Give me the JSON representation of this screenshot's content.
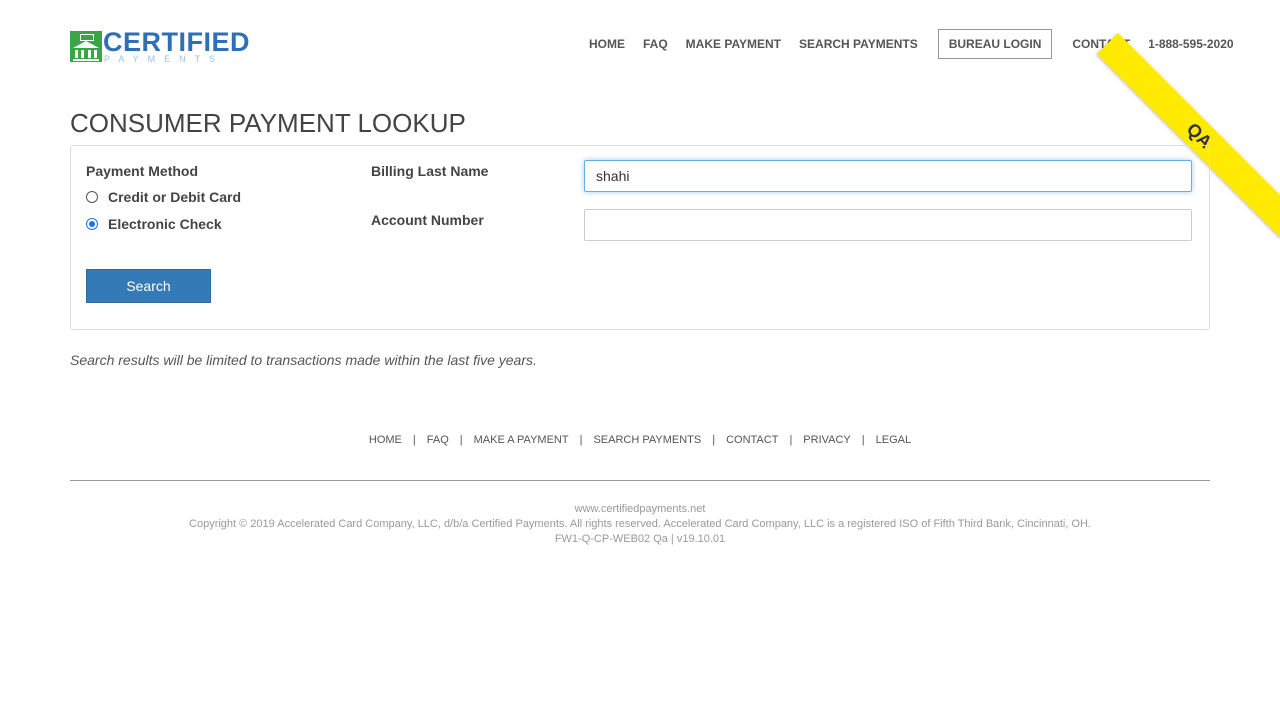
{
  "header": {
    "logo_text": "CERTIFIED",
    "logo_sub": "PAYMENTS",
    "nav": [
      {
        "label": "HOME"
      },
      {
        "label": "FAQ"
      },
      {
        "label": "MAKE PAYMENT"
      },
      {
        "label": "SEARCH PAYMENTS"
      },
      {
        "label": "BUREAU LOGIN"
      },
      {
        "label": "CONTACT"
      },
      {
        "label": "1-888-595-2020"
      }
    ],
    "ribbon": "QA"
  },
  "page": {
    "title": "CONSUMER PAYMENT LOOKUP"
  },
  "form": {
    "payment_method_label": "Payment Method",
    "options": [
      {
        "label": "Credit or Debit Card",
        "checked": false
      },
      {
        "label": "Electronic Check",
        "checked": true
      }
    ],
    "billing_last_name_label": "Billing Last Name",
    "billing_last_name_value": "shahi",
    "account_number_label": "Account Number",
    "account_number_value": "",
    "search_label": "Search"
  },
  "note": "Search results will be limited to transactions made within the last five years.",
  "footer": {
    "links": [
      {
        "label": "HOME"
      },
      {
        "label": "FAQ"
      },
      {
        "label": "MAKE A PAYMENT"
      },
      {
        "label": "SEARCH PAYMENTS"
      },
      {
        "label": "CONTACT"
      },
      {
        "label": "PRIVACY"
      },
      {
        "label": "LEGAL"
      }
    ],
    "site": "www.certifiedpayments.net",
    "copyright": "Copyright © 2019 Accelerated Card Company, LLC, d/b/a Certified Payments. All rights reserved. Accelerated Card Company, LLC is a registered ISO of Fifth Third Bank, Cincinnati, OH.",
    "version": "FW1-Q-CP-WEB02 Qa | v19.10.01"
  },
  "colors": {
    "brand_blue": "#2f6fb5",
    "brand_green": "#3aa548",
    "button": "#337ab7",
    "ribbon": "#ffea00"
  }
}
